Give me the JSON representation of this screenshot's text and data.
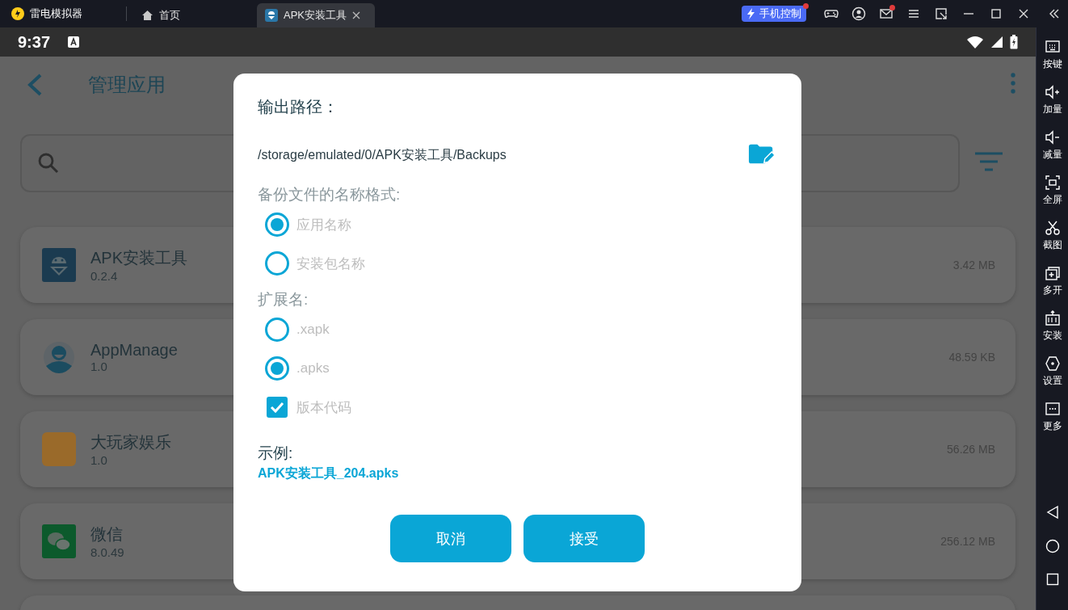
{
  "emulator_titlebar": {
    "app_name": "雷电模拟器",
    "tabs": [
      {
        "label": "首页",
        "selected": false,
        "kind": "home"
      },
      {
        "label": "APK安装工具",
        "selected": true,
        "kind": "app"
      }
    ],
    "phone_control": "手机控制"
  },
  "status_bar": {
    "time": "9:37"
  },
  "sidebar": {
    "items": [
      {
        "label": "按键"
      },
      {
        "label": "加量"
      },
      {
        "label": "减量"
      },
      {
        "label": "全屏"
      },
      {
        "label": "截图"
      },
      {
        "label": "多开"
      },
      {
        "label": "安装"
      },
      {
        "label": "设置"
      },
      {
        "label": "更多"
      }
    ]
  },
  "app": {
    "title": "管理应用",
    "apps": [
      {
        "name": "APK安装工具",
        "version": "0.2.4",
        "size": "3.42 MB"
      },
      {
        "name": "AppManage",
        "version": "1.0",
        "size": "48.59 KB"
      },
      {
        "name": "大玩家娱乐",
        "version": "1.0",
        "size": "56.26 MB"
      },
      {
        "name": "微信",
        "version": "8.0.49",
        "size": "256.12 MB"
      }
    ]
  },
  "dialog": {
    "output_path_label": "输出路径：",
    "output_path": "/storage/emulated/0/APK安装工具/Backups",
    "name_format_label": "备份文件的名称格式:",
    "name_format_options": [
      {
        "label": "应用名称",
        "selected": true
      },
      {
        "label": "安装包名称",
        "selected": false
      }
    ],
    "extension_label": "扩展名:",
    "extension_options": [
      {
        "label": ".xapk",
        "selected": false
      },
      {
        "label": ".apks",
        "selected": true
      }
    ],
    "version_code": {
      "label": "版本代码",
      "checked": true
    },
    "example_label": "示例:",
    "example": "APK安装工具_204.apks",
    "buttons": [
      "取消",
      "接受"
    ]
  }
}
